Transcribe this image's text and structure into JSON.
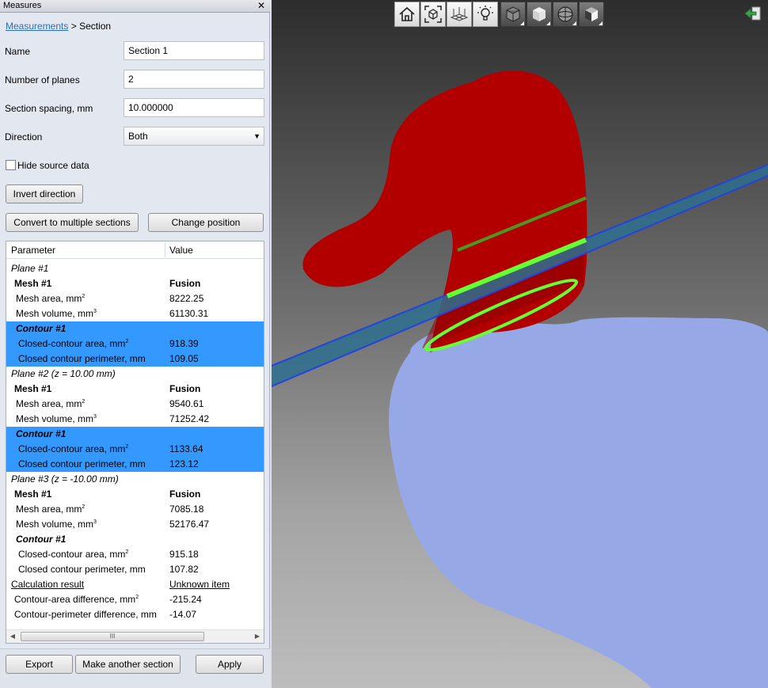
{
  "panel": {
    "title": "Measures",
    "breadcrumb": {
      "link": "Measurements",
      "separator": " > ",
      "current": "Section"
    },
    "fields": {
      "name": {
        "label": "Name",
        "value": "Section 1"
      },
      "planes": {
        "label": "Number of planes",
        "value": "2"
      },
      "spacing": {
        "label": "Section spacing, mm",
        "value": "10.000000"
      },
      "direction": {
        "label": "Direction",
        "value": "Both"
      }
    },
    "hide_source": {
      "label": "Hide source data",
      "checked": false
    },
    "buttons": {
      "invert": "Invert direction",
      "convert": "Convert to multiple sections",
      "change_position": "Change position",
      "export": "Export",
      "another": "Make another section",
      "apply": "Apply"
    }
  },
  "table": {
    "headers": {
      "parameter": "Parameter",
      "value": "Value"
    },
    "rows": {
      "p1": "Plane #1",
      "p1_mesh": {
        "label": "Mesh #1",
        "value": "Fusion"
      },
      "p1_area": {
        "label": "Mesh area, mm",
        "sup": "2",
        "value": "8222.25"
      },
      "p1_vol": {
        "label": "Mesh volume, mm",
        "sup": "3",
        "value": "61130.31"
      },
      "p1_contour": "Contour #1",
      "p1_carea": {
        "label": "Closed-contour area, mm",
        "sup": "2",
        "value": "918.39"
      },
      "p1_cper": {
        "label": "Closed contour perimeter, mm",
        "value": "109.05"
      },
      "p2": "Plane #2 (z = 10.00 mm)",
      "p2_mesh": {
        "label": "Mesh #1",
        "value": "Fusion"
      },
      "p2_area": {
        "label": "Mesh area, mm",
        "sup": "2",
        "value": "9540.61"
      },
      "p2_vol": {
        "label": "Mesh volume, mm",
        "sup": "3",
        "value": "71252.42"
      },
      "p2_contour": "Contour #1",
      "p2_carea": {
        "label": "Closed-contour area, mm",
        "sup": "2",
        "value": "1133.64"
      },
      "p2_cper": {
        "label": "Closed contour perimeter, mm",
        "value": "123.12"
      },
      "p3": "Plane #3 (z = -10.00 mm)",
      "p3_mesh": {
        "label": "Mesh #1",
        "value": "Fusion"
      },
      "p3_area": {
        "label": "Mesh area, mm",
        "sup": "2",
        "value": "7085.18"
      },
      "p3_vol": {
        "label": "Mesh volume, mm",
        "sup": "3",
        "value": "52176.47"
      },
      "p3_contour": "Contour #1",
      "p3_carea": {
        "label": "Closed-contour area, mm",
        "sup": "2",
        "value": "915.18"
      },
      "p3_cper": {
        "label": "Closed contour perimeter, mm",
        "value": "107.82"
      },
      "calc": {
        "label": "Calculation result",
        "value": "Unknown item"
      },
      "diff_area": {
        "label": "Contour-area difference, mm",
        "sup": "2",
        "value": "-215.24"
      },
      "diff_per": {
        "label": "Contour-perimeter difference, mm",
        "value": "-14.07"
      }
    },
    "scroll_grip": "III"
  },
  "viewport": {
    "toolbar": [
      "home-icon",
      "fit-view-icon",
      "grid-icon",
      "lightbulb-icon",
      "wireframe-cube-icon",
      "shaded-cube-icon",
      "sphere-icon",
      "solid-cube-icon"
    ],
    "colors": {
      "mesh_red": "#b20000",
      "mesh_blue": "#97a8e6",
      "contour_green": "#66ff33",
      "plane_blue": "#2a5d8f"
    }
  }
}
